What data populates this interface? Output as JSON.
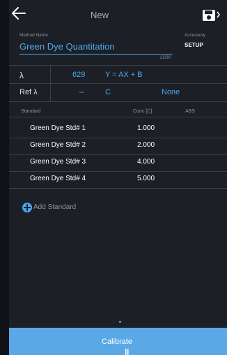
{
  "header": {
    "title": "New",
    "back_icon": "arrow-left-icon",
    "save_icon": "save-icon"
  },
  "method": {
    "label": "Method Name",
    "value": "Green Dye Quantitation",
    "counter": "22/30"
  },
  "accessory": {
    "label": "Accessory",
    "value": "SETUP"
  },
  "params": {
    "lambda_label": "λ",
    "lambda_value": "629",
    "equation": "Y = AX + B",
    "ref_label": "Ref λ",
    "ref_value": "–",
    "ref_c": "C",
    "ref_none": "None"
  },
  "table": {
    "columns": [
      "Standard",
      "Conc [C]",
      "ABS"
    ],
    "rows": [
      {
        "name": "Green Dye Std# 1",
        "conc": "1.000",
        "abs": ""
      },
      {
        "name": "Green Dye Std# 2",
        "conc": "2.000",
        "abs": ""
      },
      {
        "name": "Green Dye Std# 3",
        "conc": "4.000",
        "abs": ""
      },
      {
        "name": "Green Dye Std# 4",
        "conc": "5.000",
        "abs": ""
      }
    ]
  },
  "add_standard": {
    "label": "Add Standard",
    "icon": "plus-circle-icon"
  },
  "footer": {
    "calibrate_label": "Calibrate"
  },
  "colors": {
    "background": "#1c1f25",
    "accent": "#4aa8f0",
    "button": "#5aa9e6",
    "divider": "#3a3f48"
  }
}
